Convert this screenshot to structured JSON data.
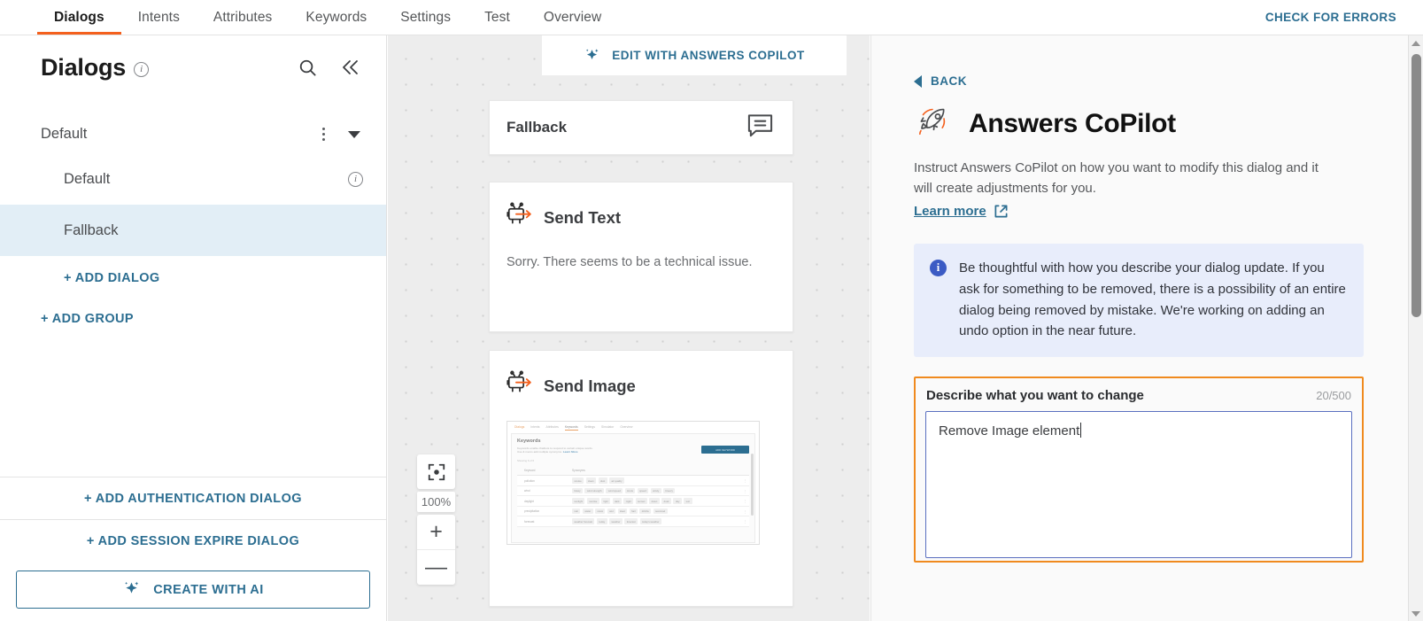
{
  "topbar": {
    "tabs": [
      {
        "label": "Dialogs",
        "active": true
      },
      {
        "label": "Intents",
        "active": false
      },
      {
        "label": "Attributes",
        "active": false
      },
      {
        "label": "Keywords",
        "active": false
      },
      {
        "label": "Settings",
        "active": false
      },
      {
        "label": "Test",
        "active": false
      },
      {
        "label": "Overview",
        "active": false
      }
    ],
    "check_errors": "CHECK FOR ERRORS",
    "accent_orange": "#f4601d",
    "accent_blue": "#2c6e91"
  },
  "sidebar": {
    "title": "Dialogs",
    "info_glyph": "i",
    "search_icon": "search-icon",
    "collapse_icon": "collapse-icon",
    "group": {
      "name": "Default",
      "menu_icon": "kebab-menu-icon",
      "expand_icon": "caret-down-icon"
    },
    "dialogs": [
      {
        "label": "Default",
        "selected": false,
        "has_info": true
      },
      {
        "label": "Fallback",
        "selected": true,
        "has_info": false
      }
    ],
    "add_dialog": "+ ADD DIALOG",
    "add_group": "+ ADD GROUP",
    "add_auth_dialog": "+ ADD AUTHENTICATION DIALOG",
    "add_session_expire_dialog": "+ ADD SESSION EXPIRE DIALOG",
    "create_with_ai": "CREATE WITH AI"
  },
  "canvas": {
    "copilot_cta": "EDIT WITH ANSWERS COPILOT",
    "nodes": {
      "fallback": {
        "title": "Fallback",
        "icon": "chat-bubble-icon"
      },
      "send_text": {
        "title": "Send Text",
        "body": "Sorry. There seems to be a technical issue.",
        "icon": "bot-send-icon"
      },
      "send_image": {
        "title": "Send Image",
        "icon": "bot-send-icon"
      }
    },
    "image_preview": {
      "tabs": [
        "Dialogs",
        "Intents",
        "Attributes",
        "Keywords",
        "Settings",
        "Simulator",
        "Overview"
      ],
      "active_tab": "Keywords",
      "heading": "Keywords",
      "sub": "Keywords enable chatbots to respond to certain unique words.",
      "sub2": "Use & mems add multiple synonyms.",
      "sub_link": "Learn More",
      "button": "ADD KEYWORD",
      "count": "Showing 6 of 6",
      "columns": [
        "Keyword",
        "Synonyms"
      ],
      "rows": [
        {
          "keyword": "pollution",
          "synonyms": [
            "smoke",
            "clean",
            "dust",
            "air quality"
          ]
        },
        {
          "keyword": "wind",
          "synonyms": [
            "blowy",
            "wind strength",
            "wind speed",
            "knots",
            "speed",
            "windy",
            "breezy"
          ]
        },
        {
          "keyword": "daylight",
          "synonyms": [
            "sunlight",
            "sunrise",
            "light",
            "dark",
            "night",
            "sunset",
            "dawn",
            "dusk",
            "day",
            "sun"
          ]
        },
        {
          "keyword": "precipitation",
          "synonyms": [
            "rain",
            "water",
            "snow",
            "wet",
            "sleet",
            "hail",
            "drizzle",
            "sea level"
          ]
        },
        {
          "keyword": "forecast",
          "synonyms": [
            "weather forecast",
            "today",
            "weather",
            "forecast",
            "today's weather"
          ]
        }
      ]
    },
    "zoom": {
      "fit_icon": "fit-to-screen-icon",
      "level": "100%",
      "zoom_in": "+",
      "zoom_out": "—"
    }
  },
  "right_panel": {
    "back": "BACK",
    "back_icon": "triangle-left-icon",
    "title": "Answers CoPilot",
    "title_icon": "rocket-icon",
    "description": "Instruct Answers CoPilot on how you want to modify this dialog and it will create adjustments for you.",
    "learn_more": "Learn more",
    "learn_more_icon": "external-link-icon",
    "callout": {
      "icon": "info-icon",
      "text": "Be thoughtful with how you describe your dialog update. If you ask for something to be removed, there is a possibility of an entire dialog being removed by mistake. We're working on adding an undo option in the near future.",
      "bg": "#e8edfb"
    },
    "prompt": {
      "label": "Describe what you want to change",
      "counter": "20/500",
      "value": "Remove Image element",
      "highlight_color": "#f08a1e",
      "focus_color": "#5a6fc0"
    }
  },
  "scrollbar": {
    "up_icon": "scroll-up-arrow-icon",
    "down_icon": "scroll-down-arrow-icon",
    "thumb": "scroll-thumb"
  }
}
